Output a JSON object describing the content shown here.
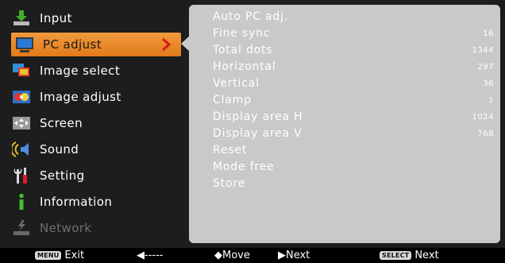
{
  "menu": {
    "items": [
      {
        "label": "Input",
        "icon": "input-arrow-icon"
      },
      {
        "label": "PC adjust",
        "icon": "monitor-icon",
        "selected": true
      },
      {
        "label": "Image select",
        "icon": "image-select-icon"
      },
      {
        "label": "Image adjust",
        "icon": "image-adjust-icon"
      },
      {
        "label": "Screen",
        "icon": "screen-icon"
      },
      {
        "label": "Sound",
        "icon": "speaker-icon"
      },
      {
        "label": "Setting",
        "icon": "tools-icon"
      },
      {
        "label": "Information",
        "icon": "info-icon"
      },
      {
        "label": "Network",
        "icon": "network-icon",
        "disabled": true
      }
    ]
  },
  "panel": {
    "rows": [
      {
        "label": "Auto PC adj.",
        "value": ""
      },
      {
        "label": "Fine sync",
        "value": "16"
      },
      {
        "label": "Total dots",
        "value": "1344"
      },
      {
        "label": "Horizontal",
        "value": "297"
      },
      {
        "label": "Vertical",
        "value": "36"
      },
      {
        "label": "Clamp",
        "value": "1"
      },
      {
        "label": "Display area H",
        "value": "1024"
      },
      {
        "label": "Display area V",
        "value": "768"
      },
      {
        "label": "Reset",
        "value": ""
      },
      {
        "label": "Mode free",
        "value": ""
      },
      {
        "label": "Store",
        "value": ""
      }
    ]
  },
  "footer": {
    "menu_badge": "MENU",
    "exit_label": "Exit",
    "back_label": "◀-----",
    "move_label": "◆Move",
    "next_label": "▶Next",
    "select_badge": "SELECT",
    "select_next_label": "Next"
  },
  "colors": {
    "accent": "#e8891f",
    "panel": "#c9c9c9",
    "background": "#1d1d1d"
  }
}
